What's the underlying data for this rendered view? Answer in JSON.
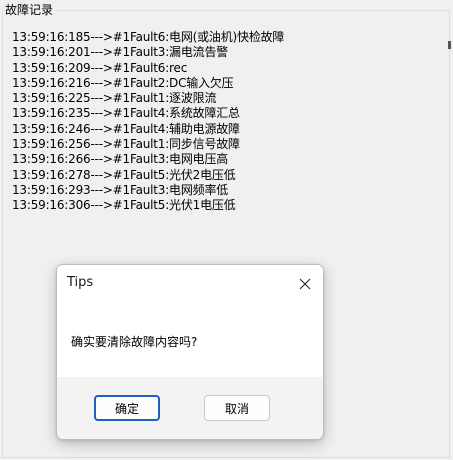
{
  "groupbox": {
    "title": "故障记录"
  },
  "log": {
    "lines": [
      "13:59:16:185--->#1Fault6:电网(或油机)快检故障",
      "13:59:16:201--->#1Fault3:漏电流告警",
      "13:59:16:209--->#1Fault6:rec",
      "13:59:16:216--->#1Fault2:DC输入欠压",
      "13:59:16:225--->#1Fault1:逐波限流",
      "13:59:16:235--->#1Fault4:系统故障汇总",
      "13:59:16:246--->#1Fault4:辅助电源故障",
      "13:59:16:256--->#1Fault1:同步信号故障",
      "13:59:16:266--->#1Fault3:电网电压高",
      "13:59:16:278--->#1Fault5:光伏2电压低",
      "13:59:16:293--->#1Fault3:电网频率低",
      "13:59:16:306--->#1Fault5:光伏1电压低"
    ]
  },
  "dialog": {
    "title": "Tips",
    "message": "确实要清除故障内容吗?",
    "ok_label": "确定",
    "cancel_label": "取消",
    "close_icon": "close-icon"
  },
  "colors": {
    "background": "#f0f0f0",
    "dialog_footer": "#f3f3f3",
    "focus_border": "#1f5fbf"
  }
}
